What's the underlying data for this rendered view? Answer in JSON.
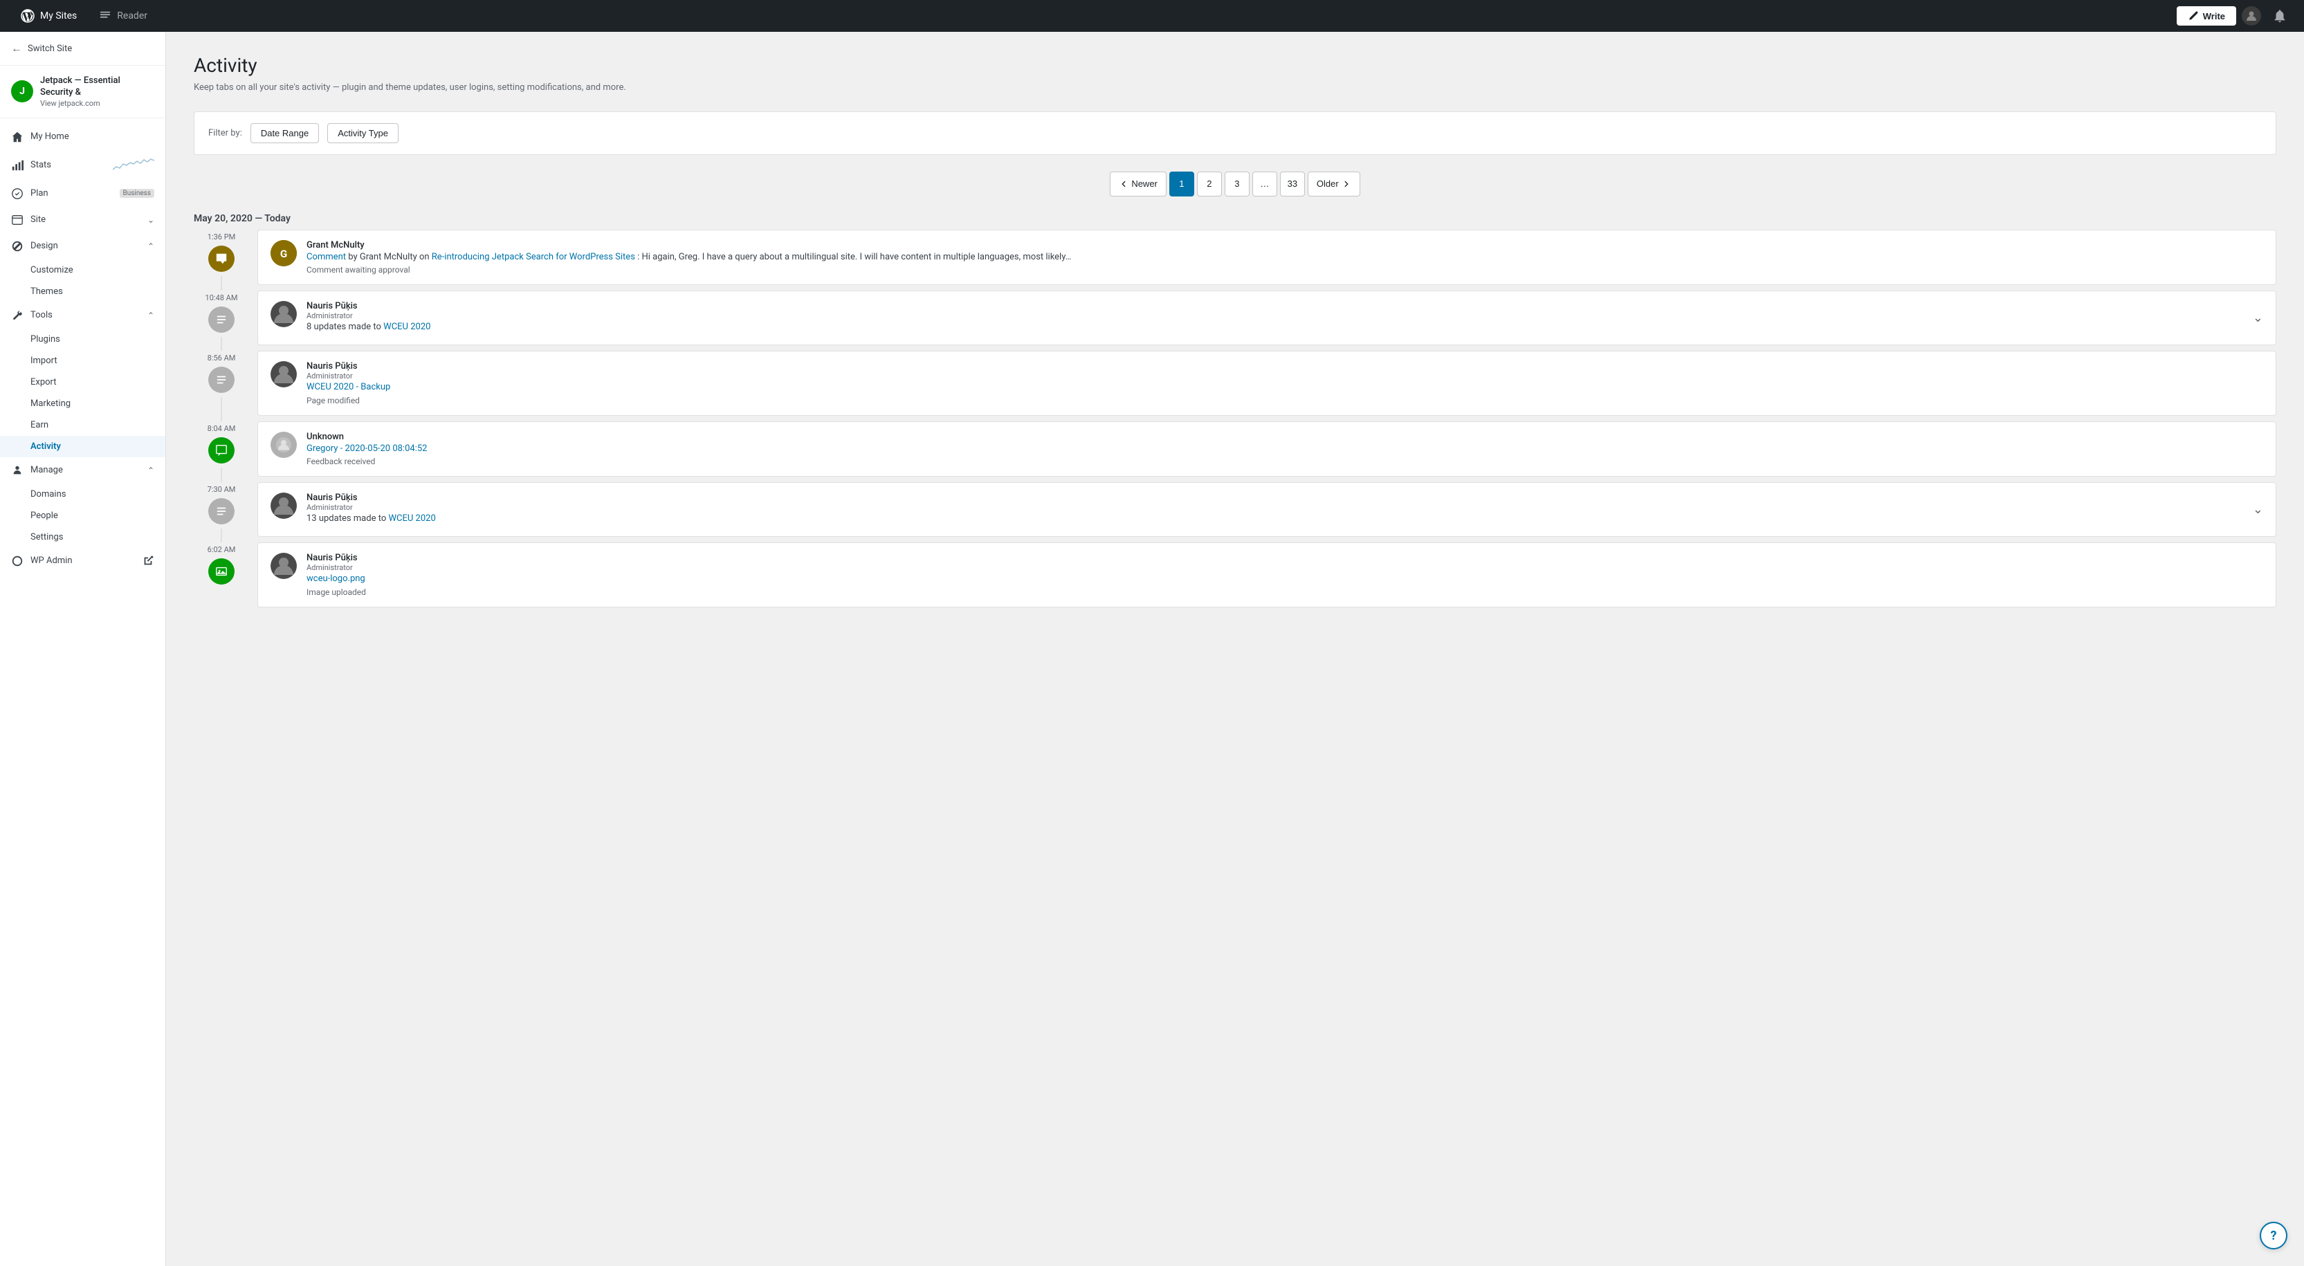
{
  "topbar": {
    "my_sites_label": "My Sites",
    "reader_label": "Reader",
    "write_label": "Write"
  },
  "sidebar": {
    "switch_site_label": "Switch Site",
    "site_name": "Jetpack — Essential Security &",
    "site_url": "View jetpack.com",
    "nav_items": [
      {
        "id": "my-home",
        "label": "My Home",
        "icon": "home",
        "has_chevron": false
      },
      {
        "id": "stats",
        "label": "Stats",
        "icon": "chart",
        "has_sparkline": true
      },
      {
        "id": "plan",
        "label": "Plan",
        "icon": "plan",
        "badge": "Business"
      },
      {
        "id": "site",
        "label": "Site",
        "icon": "site",
        "has_chevron": true,
        "expanded": true
      },
      {
        "id": "design",
        "label": "Design",
        "icon": "design",
        "has_chevron": true,
        "expanded": true
      },
      {
        "id": "tools",
        "label": "Tools",
        "icon": "tools",
        "has_chevron": true,
        "expanded": true
      },
      {
        "id": "manage",
        "label": "Manage",
        "icon": "manage",
        "has_chevron": true,
        "expanded": true
      },
      {
        "id": "wp-admin",
        "label": "WP Admin",
        "icon": "external"
      }
    ],
    "design_sub": [
      "Customize",
      "Themes"
    ],
    "tools_sub": [
      "Plugins",
      "Import",
      "Export",
      "Marketing",
      "Earn",
      "Activity"
    ],
    "manage_sub": [
      "Domains",
      "People",
      "Settings"
    ]
  },
  "page": {
    "title": "Activity",
    "subtitle": "Keep tabs on all your site's activity — plugin and theme updates, user logins, setting modifications, and more."
  },
  "filter": {
    "label": "Filter by:",
    "date_range_btn": "Date Range",
    "activity_type_btn": "Activity Type"
  },
  "pagination": {
    "newer_label": "Newer",
    "older_label": "Older",
    "pages": [
      "1",
      "2",
      "3",
      "...",
      "33"
    ],
    "current": "1"
  },
  "date_header": "May 20, 2020 — Today",
  "activities": [
    {
      "time": "1:36 PM",
      "icon_type": "comment",
      "user_name": "Grant McNulty",
      "user_role": null,
      "avatar_type": "initials",
      "avatar_initials": "G",
      "link_text": "Comment",
      "link_href": "#",
      "link_text2": "Re-introducing Jetpack Search for WordPress Sites",
      "link_href2": "#",
      "description": ": Hi again, Greg. I have a query about a multilingual site. I will have content in multiple languages, most likely…",
      "meta": "Comment awaiting approval",
      "expandable": false
    },
    {
      "time": "10:48 AM",
      "icon_type": "update",
      "user_name": "Nauris Pūķis",
      "user_role": "Administrator",
      "avatar_type": "photo",
      "link_text": "WCEU 2020",
      "link_href": "#",
      "description_prefix": "8 updates made to ",
      "meta": null,
      "expandable": true
    },
    {
      "time": "8:56 AM",
      "icon_type": "page",
      "user_name": "Nauris Pūķis",
      "user_role": "Administrator",
      "avatar_type": "photo",
      "link_text": "WCEU 2020 - Backup",
      "link_href": "#",
      "description_prefix": null,
      "meta": "Page modified",
      "expandable": false
    },
    {
      "time": "8:04 AM",
      "icon_type": "feedback",
      "user_name": "Unknown",
      "user_role": null,
      "avatar_type": "placeholder",
      "link_text": "Gregory - 2020-05-20 08:04:52",
      "link_href": "#",
      "description_prefix": null,
      "meta": "Feedback received",
      "expandable": false
    },
    {
      "time": "7:30 AM",
      "icon_type": "update",
      "user_name": "Nauris Pūķis",
      "user_role": "Administrator",
      "avatar_type": "photo",
      "link_text": "WCEU 2020",
      "link_href": "#",
      "description_prefix": "13 updates made to ",
      "meta": null,
      "expandable": true
    },
    {
      "time": "6:02 AM",
      "icon_type": "image",
      "user_name": "Nauris Pūķis",
      "user_role": "Administrator",
      "avatar_type": "photo",
      "link_text": "wceu-logo.png",
      "link_href": "#",
      "description_prefix": null,
      "meta": "Image uploaded",
      "expandable": false
    }
  ]
}
